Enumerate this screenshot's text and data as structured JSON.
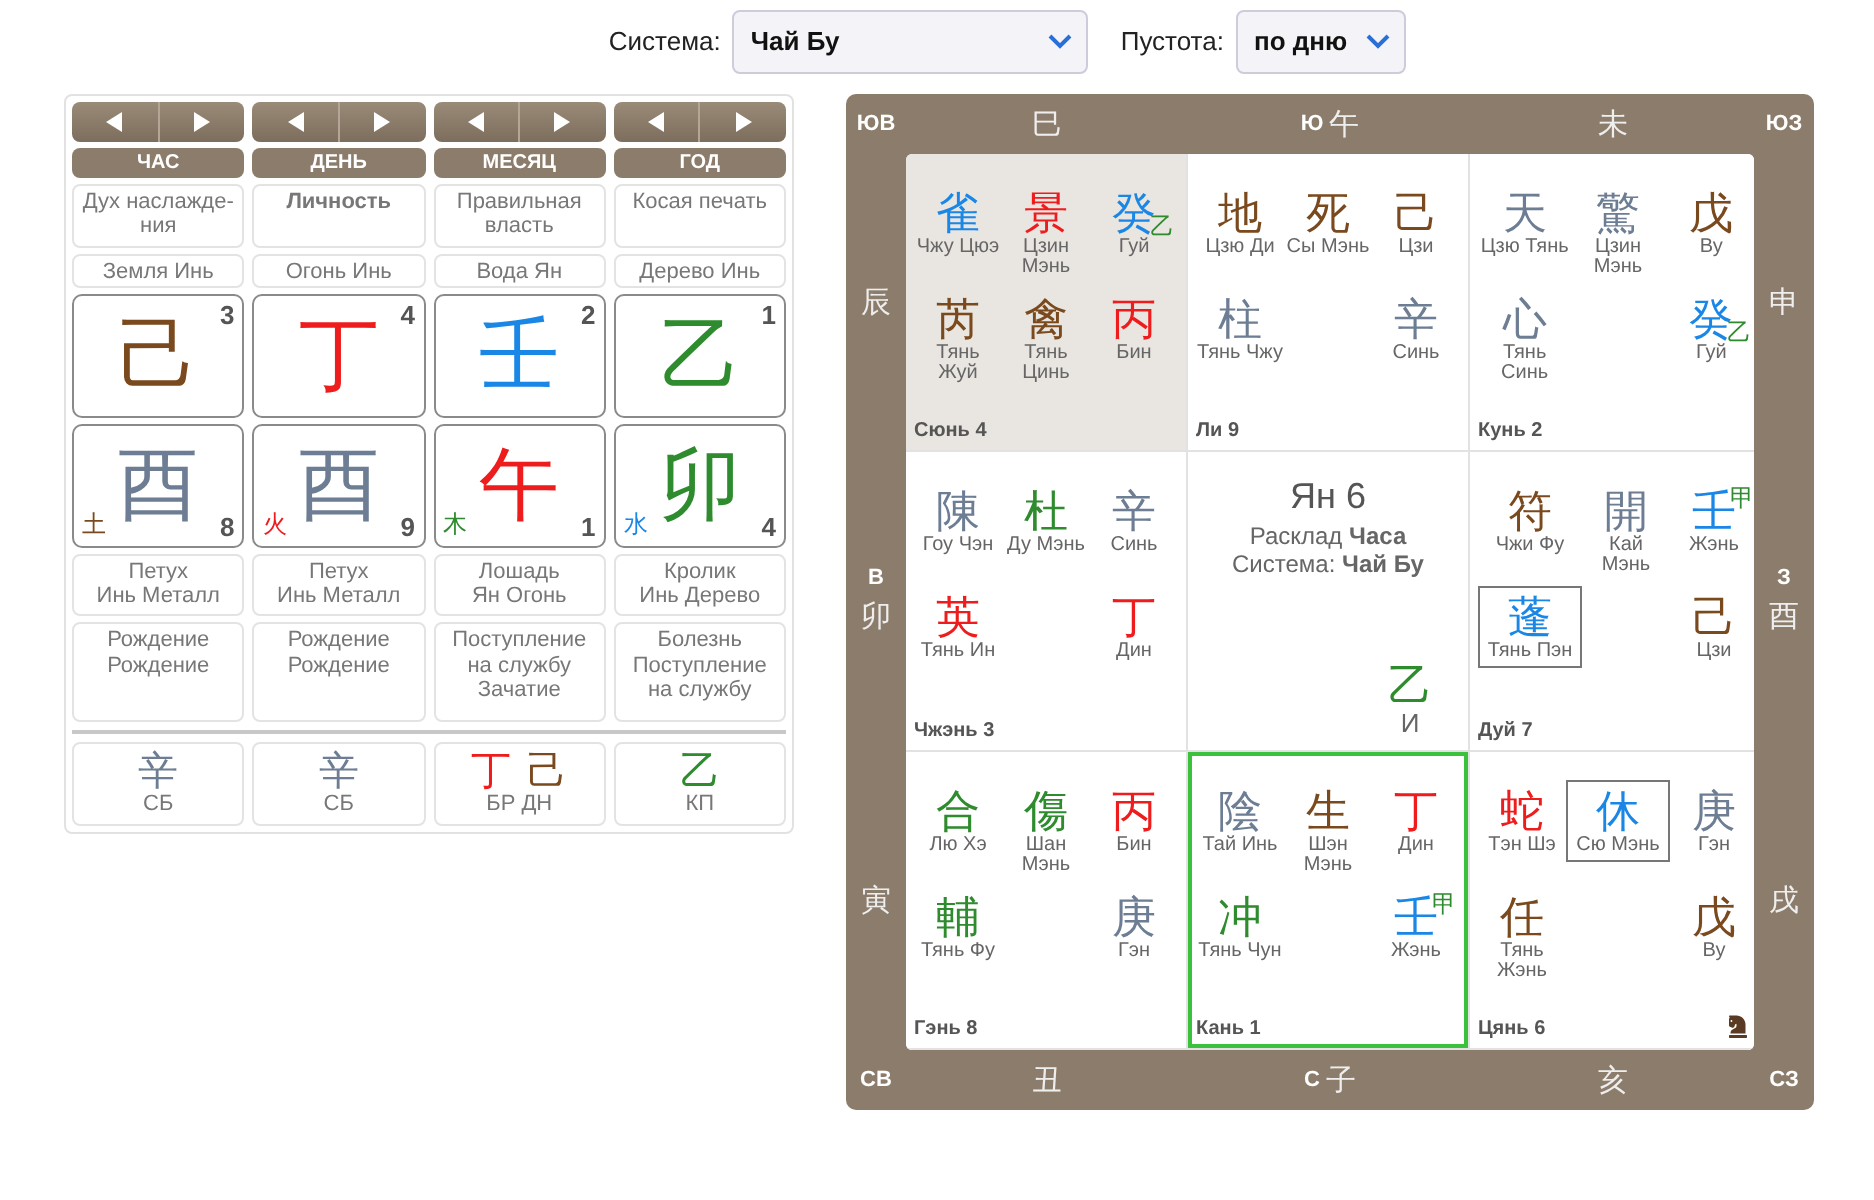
{
  "top_bar": {
    "system_label": "Система:",
    "system_value": "Чай Бу",
    "void_label": "Пустота:",
    "void_value": "по дню"
  },
  "pillars": [
    {
      "title": "ЧАС",
      "role": "Дух наслажде-ния",
      "role_highlighted": false,
      "element": "Земля Инь",
      "stem": {
        "char": "己",
        "color": "#7a4a1e",
        "number": "3"
      },
      "branch": {
        "char": "酉",
        "color": "#6d7e94",
        "number": "8",
        "element": {
          "char": "土",
          "color": "#7a4a1e"
        }
      },
      "animal": "Петух",
      "animal_element": "Инь Металл",
      "stages": [
        "Рождение",
        "Рождение"
      ],
      "hidden": [
        {
          "char": "辛",
          "color": "#6d7e94"
        }
      ],
      "hidden_label": "СБ"
    },
    {
      "title": "ДЕНЬ",
      "role": "Личность",
      "role_highlighted": true,
      "element": "Огонь Инь",
      "stem": {
        "char": "丁",
        "color": "#ee1c1c",
        "number": "4"
      },
      "branch": {
        "char": "酉",
        "color": "#6d7e94",
        "number": "9",
        "element": {
          "char": "火",
          "color": "#ee1c1c"
        }
      },
      "animal": "Петух",
      "animal_element": "Инь Металл",
      "stages": [
        "Рождение",
        "Рождение"
      ],
      "hidden": [
        {
          "char": "辛",
          "color": "#6d7e94"
        }
      ],
      "hidden_label": "СБ"
    },
    {
      "title": "МЕСЯЦ",
      "role": "Правильная власть",
      "role_highlighted": false,
      "element": "Вода Ян",
      "stem": {
        "char": "壬",
        "color": "#1a87e6",
        "number": "2"
      },
      "branch": {
        "char": "午",
        "color": "#ee1c1c",
        "number": "1",
        "element": {
          "char": "木",
          "color": "#2e8b2e"
        }
      },
      "animal": "Лошадь",
      "animal_element": "Ян Огонь",
      "stages": [
        "Поступление на службу",
        "Зачатие"
      ],
      "hidden": [
        {
          "char": "丁",
          "color": "#ee1c1c"
        },
        {
          "char": "己",
          "color": "#7a4a1e"
        }
      ],
      "hidden_label": "БР ДН"
    },
    {
      "title": "ГОД",
      "role": "Косая печать",
      "role_highlighted": false,
      "element": "Дерево Инь",
      "stem": {
        "char": "乙",
        "color": "#2e8b2e",
        "number": "1"
      },
      "branch": {
        "char": "卯",
        "color": "#2e8b2e",
        "number": "4",
        "element": {
          "char": "水",
          "color": "#1a87e6"
        }
      },
      "animal": "Кролик",
      "animal_element": "Инь Дерево",
      "stages": [
        "Болезнь",
        "Поступление на службу"
      ],
      "hidden": [
        {
          "char": "乙",
          "color": "#2e8b2e"
        }
      ],
      "hidden_label": "КП"
    }
  ],
  "board": {
    "corners": {
      "top_left": "ЮВ",
      "top_right": "ЮЗ",
      "bottom_left": "СВ",
      "bottom_right": "СЗ"
    },
    "top": [
      {
        "char": "巳"
      },
      {
        "direction": "Ю",
        "char": "午"
      },
      {
        "char": "未"
      }
    ],
    "left": [
      {
        "char": "辰"
      },
      {
        "direction": "В",
        "char": "卯"
      },
      {
        "char": "寅"
      }
    ],
    "right": [
      {
        "char": "申"
      },
      {
        "direction": "З",
        "char": "酉"
      },
      {
        "char": "戌"
      }
    ],
    "bottom": [
      {
        "char": "丑"
      },
      {
        "direction": "С",
        "char": "子"
      },
      {
        "char": "亥"
      }
    ],
    "palaces": [
      {
        "kind": "palace",
        "name": "Сюнь 4",
        "shaded": true,
        "selected": false,
        "horse": false,
        "cells": [
          {
            "kind": "star",
            "char": "雀",
            "color": "#1a87e6",
            "label": "Чжу Цюэ",
            "boxed": false
          },
          {
            "kind": "star",
            "char": "景",
            "color": "#ee1c1c",
            "label": "Цзин Мэнь",
            "boxed": false
          },
          {
            "kind": "star",
            "char": "癸",
            "color": "#1a87e6",
            "label": "Гуй",
            "boxed": false,
            "extra": {
              "kind": "sub",
              "char": "乙",
              "color": "#2e8b2e"
            }
          },
          {
            "kind": "star",
            "char": "芮",
            "color": "#7a4a1e",
            "label": "Тянь Жуй",
            "boxed": false
          },
          {
            "kind": "star",
            "char": "禽",
            "color": "#7a4a1e",
            "label": "Тянь Цинь",
            "boxed": false
          },
          {
            "kind": "star",
            "char": "丙",
            "color": "#ee1c1c",
            "label": "Бин",
            "boxed": false
          }
        ]
      },
      {
        "kind": "palace",
        "name": "Ли 9",
        "shaded": false,
        "selected": false,
        "horse": false,
        "cells": [
          {
            "kind": "star",
            "char": "地",
            "color": "#7a4a1e",
            "label": "Цзю Ди",
            "boxed": false
          },
          {
            "kind": "star",
            "char": "死",
            "color": "#7a4a1e",
            "label": "Сы Мэнь",
            "boxed": false
          },
          {
            "kind": "star",
            "char": "己",
            "color": "#7a4a1e",
            "label": "Цзи",
            "boxed": false
          },
          {
            "kind": "star",
            "char": "柱",
            "color": "#6d7e94",
            "label": "Тянь Чжу",
            "boxed": false
          },
          {
            "kind": "blank"
          },
          {
            "kind": "star",
            "char": "辛",
            "color": "#6d7e94",
            "label": "Синь",
            "boxed": false
          }
        ]
      },
      {
        "kind": "palace",
        "name": "Кунь 2",
        "shaded": false,
        "selected": false,
        "horse": false,
        "cells": [
          {
            "kind": "star",
            "char": "天",
            "color": "#6d7e94",
            "label": "Цзю Тянь",
            "boxed": false
          },
          {
            "kind": "star",
            "char": "驚",
            "color": "#6d7e94",
            "label": "Цзин Мэнь",
            "boxed": false
          },
          {
            "kind": "star",
            "char": "戊",
            "color": "#7a4a1e",
            "label": "Ву",
            "boxed": false
          },
          {
            "kind": "star",
            "char": "心",
            "color": "#6d7e94",
            "label": "Тянь Синь",
            "boxed": false
          },
          {
            "kind": "blank"
          },
          {
            "kind": "star",
            "char": "癸",
            "color": "#1a87e6",
            "label": "Гуй",
            "boxed": false,
            "extra": {
              "kind": "sub",
              "char": "乙",
              "color": "#2e8b2e"
            }
          }
        ]
      },
      {
        "kind": "palace",
        "name": "Чжэнь 3",
        "shaded": false,
        "selected": false,
        "horse": false,
        "cells": [
          {
            "kind": "star",
            "char": "陳",
            "color": "#6d7e94",
            "label": "Гоу Чэн",
            "boxed": false
          },
          {
            "kind": "star",
            "char": "杜",
            "color": "#2e8b2e",
            "label": "Ду Мэнь",
            "boxed": false
          },
          {
            "kind": "star",
            "char": "辛",
            "color": "#6d7e94",
            "label": "Синь",
            "boxed": false
          },
          {
            "kind": "star",
            "char": "英",
            "color": "#ee1c1c",
            "label": "Тянь Ин",
            "boxed": false
          },
          {
            "kind": "blank"
          },
          {
            "kind": "star",
            "char": "丁",
            "color": "#ee1c1c",
            "label": "Дин",
            "boxed": false
          }
        ]
      },
      {
        "kind": "center",
        "title": "Ян 6",
        "lines": [
          "Расклад **Часа**",
          "Система: **Чай Бу**"
        ],
        "char": "乙",
        "color": "#2e8b2e",
        "label": "И"
      },
      {
        "kind": "palace",
        "name": "Дуй 7",
        "shaded": false,
        "selected": false,
        "horse": false,
        "cells": [
          {
            "kind": "star",
            "char": "符",
            "color": "#7a4a1e",
            "label": "Чжи Фу",
            "boxed": false
          },
          {
            "kind": "star",
            "char": "開",
            "color": "#6d7e94",
            "label": "Кай Мэнь",
            "boxed": false
          },
          {
            "kind": "star",
            "char": "壬",
            "color": "#1a87e6",
            "label": "Жэнь",
            "boxed": false,
            "extra": {
              "kind": "sup",
              "char": "甲",
              "color": "#2e8b2e"
            }
          },
          {
            "kind": "star",
            "char": "蓬",
            "color": "#1a87e6",
            "label": "Тянь Пэн",
            "boxed": true
          },
          {
            "kind": "blank"
          },
          {
            "kind": "star",
            "char": "己",
            "color": "#7a4a1e",
            "label": "Цзи",
            "boxed": false
          }
        ]
      },
      {
        "kind": "palace",
        "name": "Гэнь 8",
        "shaded": false,
        "selected": false,
        "horse": false,
        "cells": [
          {
            "kind": "star",
            "char": "合",
            "color": "#2e8b2e",
            "label": "Лю Хэ",
            "boxed": false
          },
          {
            "kind": "star",
            "char": "傷",
            "color": "#2e8b2e",
            "label": "Шан Мэнь",
            "boxed": false
          },
          {
            "kind": "star",
            "char": "丙",
            "color": "#ee1c1c",
            "label": "Бин",
            "boxed": false
          },
          {
            "kind": "star",
            "char": "輔",
            "color": "#2e8b2e",
            "label": "Тянь Фу",
            "boxed": false
          },
          {
            "kind": "blank"
          },
          {
            "kind": "star",
            "char": "庚",
            "color": "#6d7e94",
            "label": "Гэн",
            "boxed": false
          }
        ]
      },
      {
        "kind": "palace",
        "name": "Кань 1",
        "shaded": false,
        "selected": true,
        "horse": false,
        "cells": [
          {
            "kind": "star",
            "char": "陰",
            "color": "#6d7e94",
            "label": "Тай Инь",
            "boxed": false
          },
          {
            "kind": "star",
            "char": "生",
            "color": "#7a4a1e",
            "label": "Шэн Мэнь",
            "boxed": false
          },
          {
            "kind": "star",
            "char": "丁",
            "color": "#ee1c1c",
            "label": "Дин",
            "boxed": false
          },
          {
            "kind": "star",
            "char": "冲",
            "color": "#2e8b2e",
            "label": "Тянь Чун",
            "boxed": false
          },
          {
            "kind": "blank"
          },
          {
            "kind": "star",
            "char": "壬",
            "color": "#1a87e6",
            "label": "Жэнь",
            "boxed": false,
            "extra": {
              "kind": "sup",
              "char": "甲",
              "color": "#2e8b2e"
            }
          }
        ]
      },
      {
        "kind": "palace",
        "name": "Цянь 6",
        "shaded": false,
        "selected": false,
        "horse": true,
        "cells": [
          {
            "kind": "star",
            "char": "蛇",
            "color": "#ee1c1c",
            "label": "Тэн Шэ",
            "boxed": false
          },
          {
            "kind": "star",
            "char": "休",
            "color": "#1a87e6",
            "label": "Сю Мэнь",
            "boxed": true
          },
          {
            "kind": "star",
            "char": "庚",
            "color": "#6d7e94",
            "label": "Гэн",
            "boxed": false
          },
          {
            "kind": "star",
            "char": "任",
            "color": "#7a4a1e",
            "label": "Тянь Жэнь",
            "boxed": false
          },
          {
            "kind": "blank"
          },
          {
            "kind": "star",
            "char": "戊",
            "color": "#7a4a1e",
            "label": "Ву",
            "boxed": false
          }
        ]
      }
    ]
  }
}
